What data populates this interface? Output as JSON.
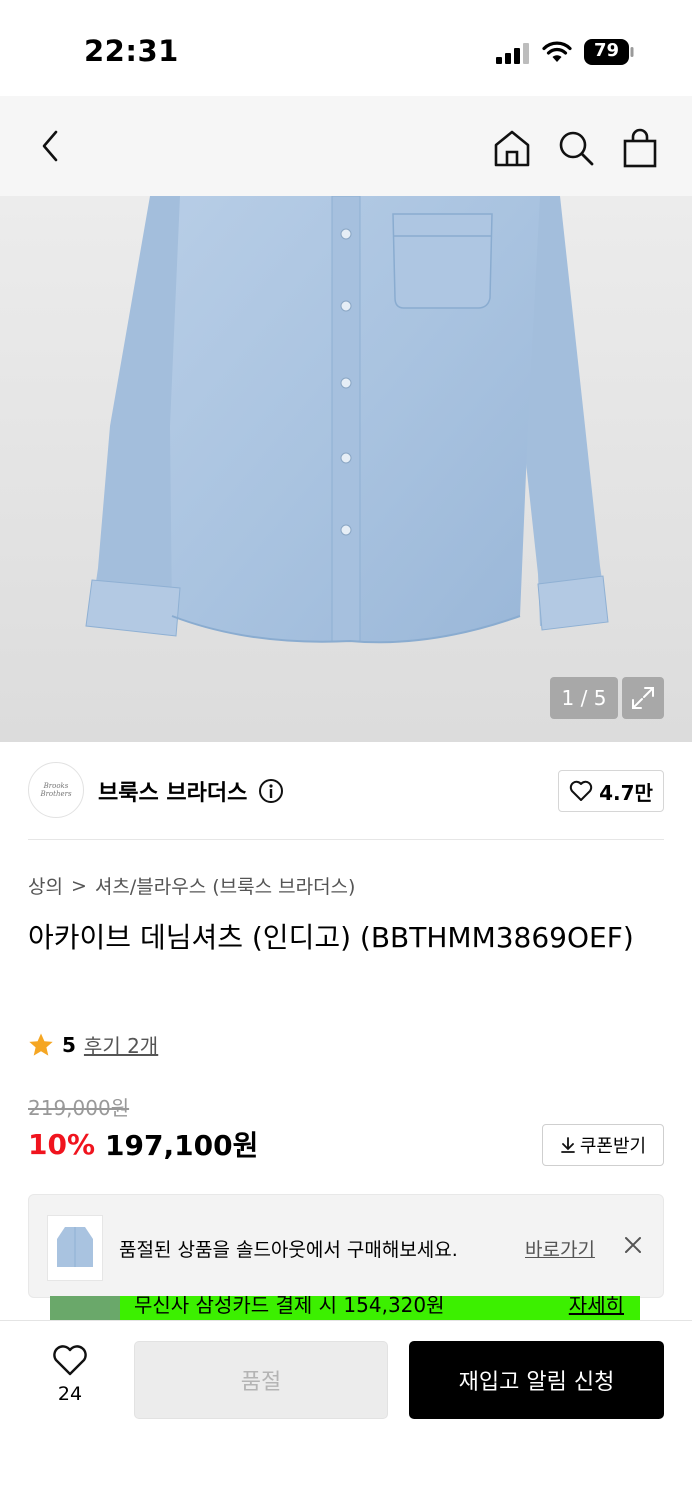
{
  "status_bar": {
    "time": "22:31",
    "battery": "79"
  },
  "nav": {
    "icons": [
      "back-icon",
      "home-icon",
      "search-icon",
      "shopping-bag-icon"
    ]
  },
  "gallery": {
    "counter": "1 / 5",
    "current": 1,
    "total": 5
  },
  "brand": {
    "name": "브룩스 브라더스",
    "logo_text": "Brooks Brothers",
    "likes": "4.7만"
  },
  "product": {
    "breadcrumb": [
      "상의",
      "셔츠/블라우스 (브룩스 브라더스)"
    ],
    "title": "아카이브 데님셔츠 (인디고) (BBTHMM3869OEF)",
    "rating": "5",
    "reviews": "후기 2개",
    "original_price": "219,000원",
    "discount": "10%",
    "sale_price": "197,100원",
    "coupon_label": "쿠폰받기"
  },
  "soldout_banner": {
    "text": "품절된 상품을 솔드아웃에서 구매해보세요.",
    "link": "바로가기"
  },
  "card_promo": {
    "text": "무신사 삼성카드 결제 시 154,320원",
    "link": "자세히"
  },
  "bottom_bar": {
    "wish_count": "24",
    "soldout_label": "품절",
    "restock_label": "재입고 알림 신청"
  },
  "colors": {
    "accent_red": "#f0141e",
    "promo_green": "#3cf000",
    "denim": "#a9c3e0"
  }
}
